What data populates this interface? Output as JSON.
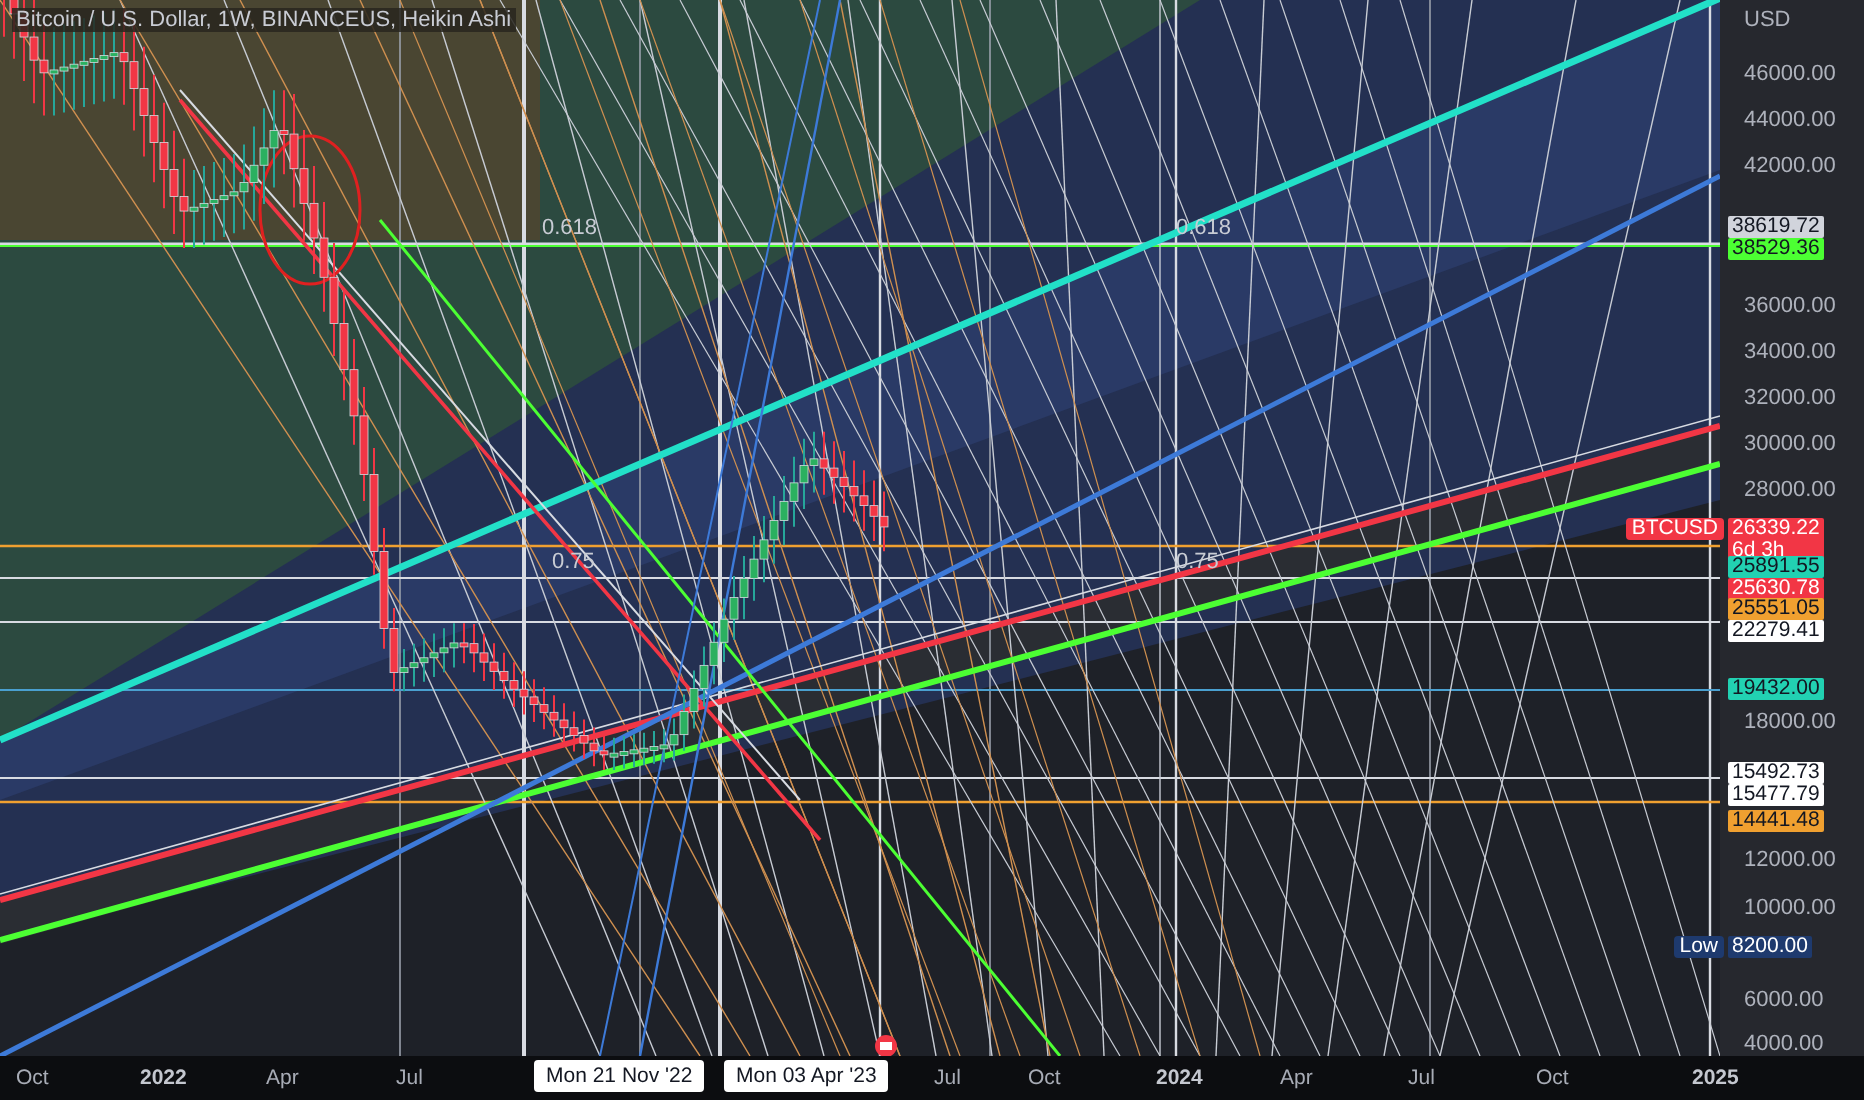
{
  "chart": {
    "title": "Bitcoin / U.S. Dollar, 1W, BINANCEUS, Heikin Ashi",
    "fib_labels": [
      {
        "text": "0.618"
      },
      {
        "text": "0.618"
      },
      {
        "text": "0.75"
      },
      {
        "text": "0.75"
      }
    ]
  },
  "price_axis": {
    "currency": "USD",
    "ticks": [
      "46000.00",
      "44000.00",
      "42000.00",
      "36000.00",
      "34000.00",
      "32000.00",
      "30000.00",
      "28000.00",
      "18000.00",
      "12000.00",
      "10000.00",
      "6000.00",
      "4000.00"
    ],
    "tags": [
      {
        "value": "38619.72",
        "color": "#d1d4dc"
      },
      {
        "value": "38529.36",
        "color": "#4cff33"
      },
      {
        "value": "26339.22",
        "color": "#f23645",
        "symbol": "BTCUSD",
        "countdown": "6d 3h"
      },
      {
        "value": "25891.55",
        "color": "#22d1b2"
      },
      {
        "value": "25630.78",
        "color": "#f23645"
      },
      {
        "value": "25551.05",
        "color": "#f0a030"
      },
      {
        "value": "22279.41",
        "color": "#ffffff"
      },
      {
        "value": "19432.00",
        "color": "#22d1b2"
      },
      {
        "value": "15492.73",
        "color": "#ffffff"
      },
      {
        "value": "15477.79",
        "color": "#ffffff"
      },
      {
        "value": "14441.48",
        "color": "#f0a030"
      },
      {
        "value": "8200.00",
        "color": "#1e3a6e",
        "label": "Low"
      }
    ]
  },
  "time_axis": {
    "ticks": [
      {
        "text": "Oct",
        "kind": "month"
      },
      {
        "text": "2022",
        "kind": "year"
      },
      {
        "text": "Apr",
        "kind": "month"
      },
      {
        "text": "Jul",
        "kind": "month"
      },
      {
        "text": "Jul",
        "kind": "month"
      },
      {
        "text": "Oct",
        "kind": "month"
      },
      {
        "text": "2024",
        "kind": "year"
      },
      {
        "text": "Apr",
        "kind": "month"
      },
      {
        "text": "Jul",
        "kind": "month"
      },
      {
        "text": "Oct",
        "kind": "month"
      },
      {
        "text": "2025",
        "kind": "year"
      }
    ],
    "crosshair_labels": [
      "Mon 21 Nov '22",
      "Mon 03 Apr '23"
    ]
  }
}
